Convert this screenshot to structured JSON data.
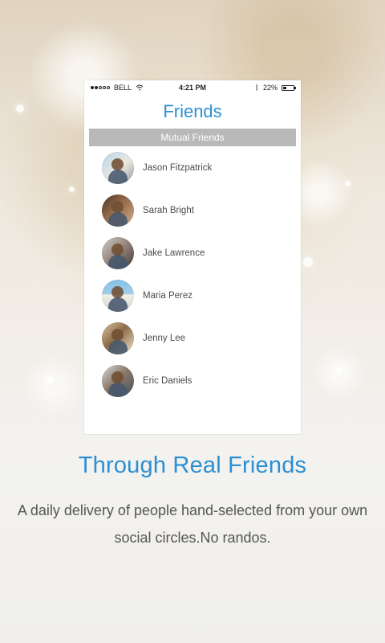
{
  "status_bar": {
    "carrier": "BELL",
    "time": "4:21 PM",
    "battery": "22%"
  },
  "screen": {
    "title": "Friends",
    "section_header": "Mutual Friends",
    "friends": [
      {
        "name": "Jason Fitzpatrick"
      },
      {
        "name": "Sarah Bright"
      },
      {
        "name": "Jake Lawrence"
      },
      {
        "name": "Maria Perez"
      },
      {
        "name": "Jenny Lee"
      },
      {
        "name": "Eric Daniels"
      }
    ]
  },
  "promo": {
    "headline": "Through Real Friends",
    "description": "A daily delivery of people hand-selected from your own social circles.No randos."
  },
  "colors": {
    "accent": "#2b8fd4",
    "section_header": "#b9b9b9",
    "text": "#555555"
  },
  "icons": {
    "signal": "signal-dots-icon",
    "wifi": "wifi-icon",
    "bluetooth": "bluetooth-icon",
    "battery": "battery-icon",
    "avatar": "avatar"
  }
}
